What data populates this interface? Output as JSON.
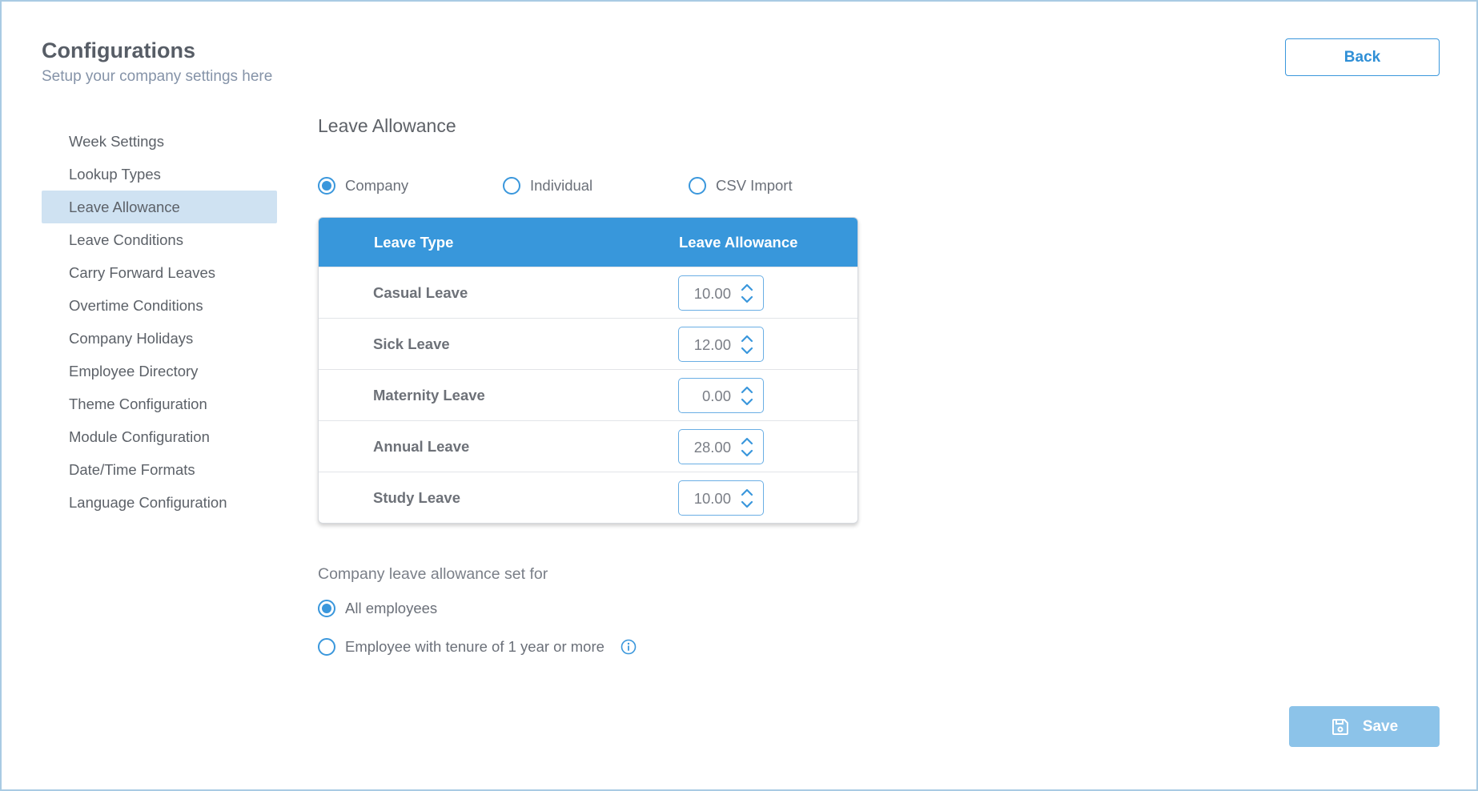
{
  "header": {
    "title": "Configurations",
    "subtitle": "Setup your company settings here",
    "back_label": "Back"
  },
  "sidebar": {
    "items": [
      {
        "label": "Week Settings",
        "active": false
      },
      {
        "label": "Lookup Types",
        "active": false
      },
      {
        "label": "Leave Allowance",
        "active": true
      },
      {
        "label": "Leave Conditions",
        "active": false
      },
      {
        "label": "Carry Forward Leaves",
        "active": false
      },
      {
        "label": "Overtime Conditions",
        "active": false
      },
      {
        "label": "Company Holidays",
        "active": false
      },
      {
        "label": "Employee Directory",
        "active": false
      },
      {
        "label": "Theme Configuration",
        "active": false
      },
      {
        "label": "Module Configuration",
        "active": false
      },
      {
        "label": "Date/Time Formats",
        "active": false
      },
      {
        "label": "Language Configuration",
        "active": false
      }
    ]
  },
  "main": {
    "section_title": "Leave Allowance",
    "mode_options": [
      {
        "label": "Company",
        "checked": true
      },
      {
        "label": "Individual",
        "checked": false
      },
      {
        "label": "CSV Import",
        "checked": false
      }
    ],
    "table": {
      "headers": {
        "type": "Leave Type",
        "allowance": "Leave Allowance"
      },
      "rows": [
        {
          "type": "Casual Leave",
          "value": "10.00"
        },
        {
          "type": "Sick Leave",
          "value": "12.00"
        },
        {
          "type": "Maternity Leave",
          "value": "0.00"
        },
        {
          "type": "Annual Leave",
          "value": "28.00"
        },
        {
          "type": "Study Leave",
          "value": "10.00"
        }
      ]
    },
    "set_for": {
      "label": "Company leave allowance set for",
      "options": [
        {
          "label": "All employees",
          "checked": true
        },
        {
          "label": "Employee with tenure of 1 year or more",
          "checked": false
        }
      ]
    },
    "save_label": "Save"
  },
  "icons": {
    "info": "info-icon",
    "save": "floppy-disk-icon",
    "spinner_up": "chevron-up-icon",
    "spinner_down": "chevron-down-icon"
  },
  "colors": {
    "accent": "#3897db",
    "active_nav": "#cfe2f2",
    "save_button": "#8cc3e9",
    "frame_border": "#a9cbe3"
  }
}
